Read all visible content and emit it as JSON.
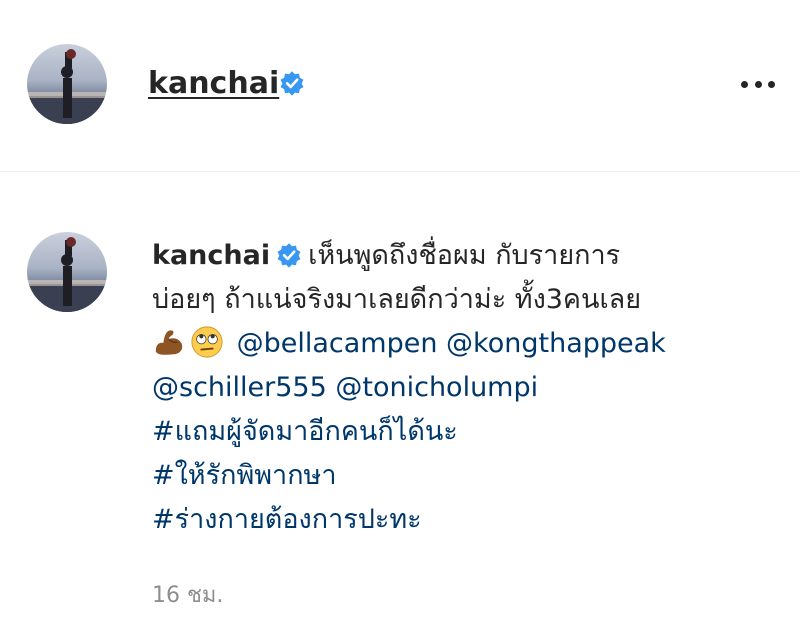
{
  "header": {
    "username": "kanchai",
    "verified_icon": "verified-badge-icon",
    "more_icon": "more-options-icon"
  },
  "comment": {
    "username": "kanchai",
    "text_line1": "เห็นพูดถึงชื่อผม กับรายการ",
    "text_line2": "บ่อยๆ ถ้าแน่จริงมาเลยดีกว่าม่ะ ทั้ง3คนเลย",
    "emojis": [
      "flexed-biceps-emoji",
      "rolling-eyes-emoji"
    ],
    "mentions": [
      "@bellacampen",
      "@kongthappeak",
      "@schiller555",
      "@tonicholumpi"
    ],
    "hashtags": [
      "#แถมผู้จัดมาอีกคนก็ได้นะ",
      "#ให้รักพิพากษา",
      "#ร่างกายต้องการปะทะ"
    ],
    "timestamp": "16 ชม."
  },
  "colors": {
    "text": "#262626",
    "link": "#00376b",
    "verified": "#3897f0",
    "muted": "#8e8e8e"
  }
}
